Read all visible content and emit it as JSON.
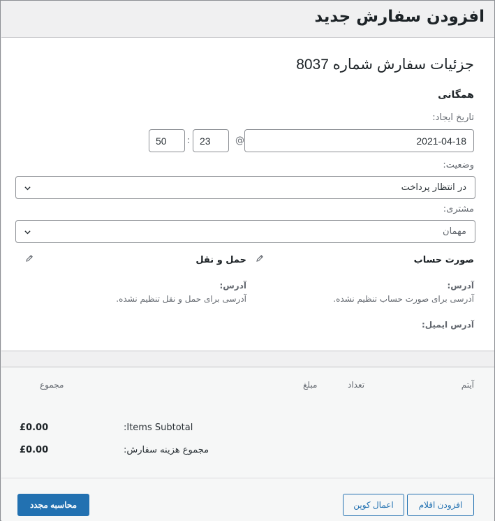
{
  "page": {
    "title": "افزودن سفارش جدید"
  },
  "order": {
    "heading": "جزئیات سفارش شماره 8037",
    "general_title": "همگانی",
    "created_label": "تاریخ ایجاد:",
    "date": "2021-04-18",
    "at_symbol": "@",
    "hour": "23",
    "time_separator": ":",
    "minute": "50",
    "status_label": "وضعیت:",
    "status_value": "در انتظار پرداخت",
    "customer_label": "مشتری:",
    "customer_value": "مهمان",
    "billing": {
      "title": "صورت حساب",
      "address_label": "آدرس:",
      "address_text": "آدرسی برای صورت حساب تنظیم نشده."
    },
    "shipping": {
      "title": "حمل و نقل",
      "address_label": "آدرس:",
      "address_text": "آدرسی برای حمل و نقل تنظیم نشده."
    },
    "email_label": "آدرس ایمیل:"
  },
  "items": {
    "columns": {
      "item": "آیتم",
      "cost": "مبلغ",
      "qty": "تعداد",
      "total": "مجموع"
    },
    "subtotal_label": "Items Subtotal:",
    "subtotal_value": "£0.00",
    "order_total_label": "مجموع هزینه سفارش:",
    "order_total_value": "£0.00"
  },
  "actions": {
    "add_items": "افزودن اقلام",
    "apply_coupon": "اعمال کوپن",
    "recalculate": "محاسبه مجدد"
  },
  "colors": {
    "accent": "#2271b1",
    "muted_text": "#646970",
    "border": "#8c8f94"
  },
  "icons": {
    "select_arrow": "chevron-down-icon",
    "edit": "pencil-icon"
  }
}
